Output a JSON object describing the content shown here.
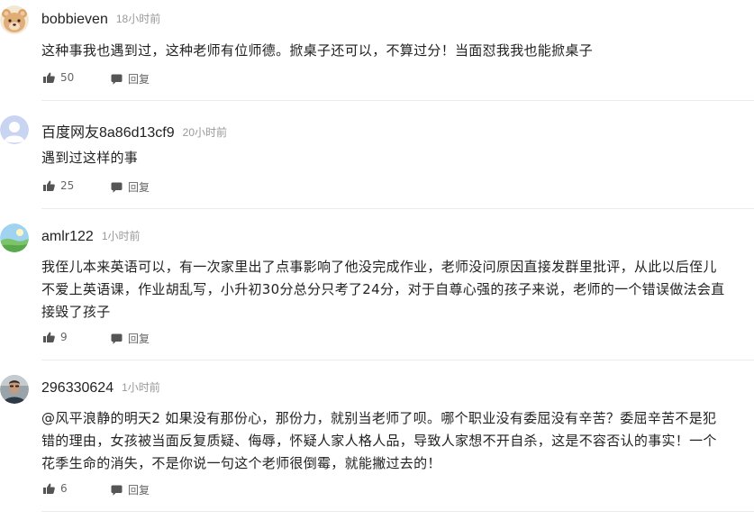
{
  "comments": [
    {
      "user": "bobbieven",
      "time": "18小时前",
      "avatar": "bear-avatar",
      "lines": [
        "这种事我也遇到过，这种老师有位师德。掀桌子还可以，不算过分！当面怼我我也能掀桌子"
      ],
      "likes": "50",
      "reply": "回复"
    },
    {
      "user": "百度网友8a86d13cf9",
      "time": "20小时前",
      "avatar": "default-user-avatar",
      "lines": [
        "遇到过这样的事"
      ],
      "likes": "25",
      "reply": "回复"
    },
    {
      "user": "amlr122",
      "time": "1小时前",
      "avatar": "landscape-avatar",
      "lines": [
        "我侄儿本来英语可以，有一次家里出了点事影响了他没完成作业，老师没问原因直接发群里批评，从此以后侄儿",
        "不爱上英语课，作业胡乱写，小升初30分总分只考了24分，对于自尊心强的孩子来说，老师的一个错误做法会直",
        "接毁了孩子"
      ],
      "likes": "9",
      "reply": "回复"
    },
    {
      "user": "296330624",
      "time": "1小时前",
      "avatar": "photo-avatar",
      "lines": [
        "@风平浪静的明天2 如果没有那份心，那份力，就别当老师了呗。哪个职业没有委屈没有辛苦？委屈辛苦不是犯",
        "错的理由，女孩被当面反复质疑、侮辱，怀疑人家人格人品，导致人家想不开自杀，这是不容否认的事实！一个",
        "花季生命的消失，不是你说一句这个老师很倒霉，就能撇过去的！"
      ],
      "likes": "6",
      "reply": "回复"
    }
  ],
  "colors": {
    "text": "#222222",
    "meta": "#999999",
    "action": "#666666",
    "divider": "#ececec",
    "background": "#ffffff"
  },
  "icons": {
    "like": "thumbs-up-icon",
    "reply": "speech-bubble-icon"
  }
}
